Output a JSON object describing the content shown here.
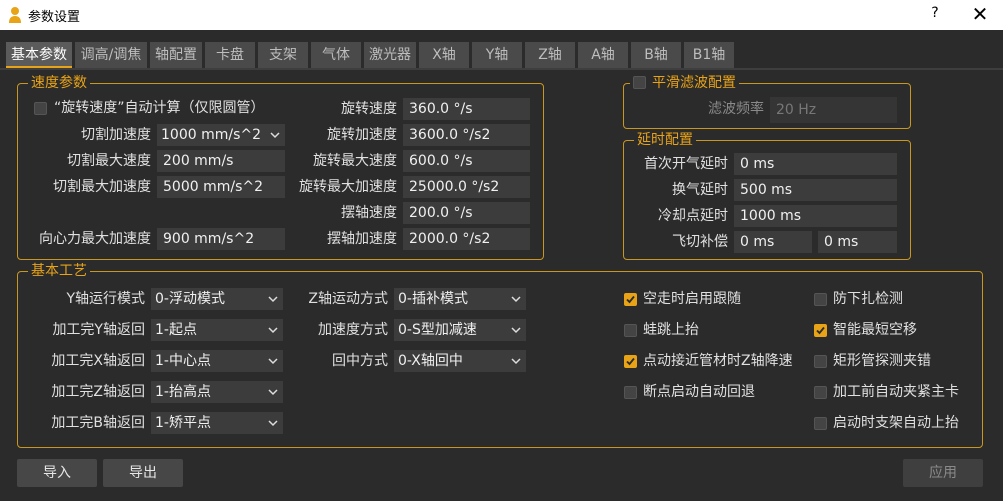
{
  "window": {
    "title": "参数设置",
    "help": "?",
    "close": "✕"
  },
  "tabs": [
    "基本参数",
    "调高/调焦",
    "轴配置",
    "卡盘",
    "支架",
    "气体",
    "激光器",
    "X轴",
    "Y轴",
    "Z轴",
    "A轴",
    "B轴",
    "B1轴"
  ],
  "speed": {
    "legend": "速度参数",
    "rotate_auto_label": "“旋转速度”自动计算（仅限圆管）",
    "cut_accel_label": "切割加速度",
    "cut_accel_value": "1000 mm/s^2",
    "cut_max_speed_label": "切割最大速度",
    "cut_max_speed_value": "200 mm/s",
    "cut_max_accel_label": "切割最大加速度",
    "cut_max_accel_value": "5000 mm/s^2",
    "centripetal_label": "向心力最大加速度",
    "centripetal_value": "900 mm/s^2",
    "rot_speed_label": "旋转速度",
    "rot_speed_value": "360.0 °/s",
    "rot_accel_label": "旋转加速度",
    "rot_accel_value": "3600.0 °/s2",
    "rot_max_speed_label": "旋转最大速度",
    "rot_max_speed_value": "600.0 °/s",
    "rot_max_accel_label": "旋转最大加速度",
    "rot_max_accel_value": "25000.0 °/s2",
    "swing_speed_label": "摆轴速度",
    "swing_speed_value": "200.0 °/s",
    "swing_accel_label": "摆轴加速度",
    "swing_accel_value": "2000.0 °/s2"
  },
  "smooth": {
    "legend": "平滑滤波配置",
    "freq_label": "滤波频率",
    "freq_value": "20 Hz"
  },
  "delay": {
    "legend": "延时配置",
    "first_label": "首次开气延时",
    "first_value": "0 ms",
    "swap_label": "换气延时",
    "swap_value": "500 ms",
    "cool_label": "冷却点延时",
    "cool_value": "1000 ms",
    "fly_label": "飞切补偿",
    "fly_value1": "0 ms",
    "fly_value2": "0 ms"
  },
  "process": {
    "legend": "基本工艺",
    "y_mode_label": "Y轴运行模式",
    "y_mode_value": "0-浮动模式",
    "y_return_label": "加工完Y轴返回",
    "y_return_value": "1-起点",
    "x_return_label": "加工完X轴返回",
    "x_return_value": "1-中心点",
    "z_return_label": "加工完Z轴返回",
    "z_return_value": "1-抬高点",
    "b_return_label": "加工完B轴返回",
    "b_return_value": "1-矫平点",
    "z_motion_label": "Z轴运动方式",
    "z_motion_value": "0-插补模式",
    "accel_mode_label": "加速度方式",
    "accel_mode_value": "0-S型加减速",
    "center_label": "回中方式",
    "center_value": "0-X轴回中",
    "checks_left": [
      {
        "label": "空走时启用跟随",
        "checked": true
      },
      {
        "label": "蛙跳上抬",
        "checked": false
      },
      {
        "label": "点动接近管材时Z轴降速",
        "checked": true
      },
      {
        "label": "断点启动自动回退",
        "checked": false
      }
    ],
    "checks_right": [
      {
        "label": "防下扎检测",
        "checked": false
      },
      {
        "label": "智能最短空移",
        "checked": true
      },
      {
        "label": "矩形管探测夹错",
        "checked": false
      },
      {
        "label": "加工前自动夹紧主卡",
        "checked": false
      },
      {
        "label": "启动时支架自动上抬",
        "checked": false
      }
    ]
  },
  "buttons": {
    "import": "导入",
    "export": "导出",
    "apply": "应用"
  },
  "colors": {
    "accent": "#e8a317",
    "background": "#2b2b2b",
    "field": "#3c3c3c"
  }
}
